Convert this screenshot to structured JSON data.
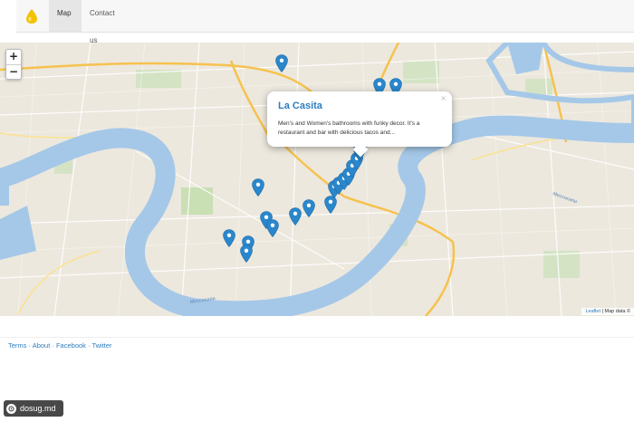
{
  "nav": {
    "brand_icon": "water-drop-icon",
    "brand_color": "#f2c200",
    "tabs": [
      {
        "label": "Map",
        "active": true
      },
      {
        "label": "Contact us",
        "active": false
      }
    ]
  },
  "map": {
    "zoom_in": "+",
    "zoom_out": "−",
    "marker_color": "#2a87cc",
    "popup": {
      "title": "La Casita",
      "text": "Men's and Women's bathrooms with funky decor. It's a restaurant and bar with delicious tacos and...",
      "close": "×"
    },
    "attribution": {
      "leaflet": "Leaflet",
      "separator": " | ",
      "text": "Map data © "
    },
    "river_label": "Миссисипи",
    "river_label_2": "Миссисипи"
  },
  "footer": {
    "links": [
      "Terms",
      "About",
      "Facebook",
      "Twitter"
    ],
    "separator": " · "
  },
  "watermark": {
    "text": "dosug.md"
  }
}
